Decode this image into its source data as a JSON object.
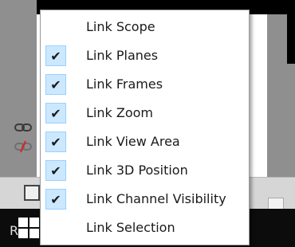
{
  "menu": {
    "items": [
      {
        "label": "Link Scope",
        "checked": false
      },
      {
        "label": "Link Planes",
        "checked": true
      },
      {
        "label": "Link Frames",
        "checked": true
      },
      {
        "label": "Link Zoom",
        "checked": true
      },
      {
        "label": "Link View Area",
        "checked": true
      },
      {
        "label": "Link 3D Position",
        "checked": true
      },
      {
        "label": "Link Channel Visibility",
        "checked": true
      },
      {
        "label": "Link Selection",
        "checked": false
      }
    ],
    "check_glyph": "✔"
  },
  "background": {
    "taskbar_letter": "R"
  },
  "icons": {
    "link": "link-icon",
    "unlink": "unlink-icon",
    "windows_logo": "windows-logo-icon"
  },
  "colors": {
    "check_highlight": "#cce8ff",
    "check_border": "#99d1ff",
    "menu_bg": "#ffffff",
    "taskbar": "#0c0c0c"
  }
}
